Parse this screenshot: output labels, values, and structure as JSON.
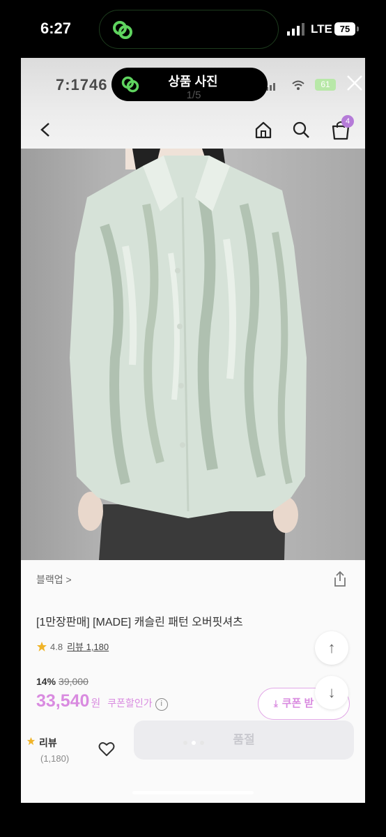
{
  "status_bar": {
    "time": "6:27",
    "network": "LTE",
    "battery": "75"
  },
  "inner_status": {
    "time": "7:1746",
    "battery": "61"
  },
  "viewer": {
    "title": "상품 사진",
    "counter": "1/5"
  },
  "shop_nav": {
    "cart_count": "4"
  },
  "product": {
    "category": "블랙업 >",
    "title": "[1만장판매] [MADE] 캐슬린 패턴 오버핏셔츠",
    "rating": "4.8",
    "review_link": "리뷰 1,180",
    "discount": "14%",
    "original_price": "39,000",
    "price": "33,540",
    "currency": "원",
    "coupon_note": "쿠폰할인가",
    "info_icon": "i"
  },
  "coupon_button": {
    "label": "쿠폰 받"
  },
  "bottom_bar": {
    "review_label": "리뷰",
    "review_count": "(1,180)",
    "buy_label": "품절"
  },
  "colors": {
    "accent": "#d98be0",
    "badge": "#b57bd8",
    "island_icon": "#5fd45f"
  },
  "icons": [
    "link-icon",
    "signal-icon",
    "close-icon",
    "back-icon",
    "home-icon",
    "search-icon",
    "bag-icon",
    "share-icon",
    "star-icon",
    "info-icon",
    "arrow-up-icon",
    "arrow-down-icon",
    "download-icon",
    "heart-icon"
  ]
}
